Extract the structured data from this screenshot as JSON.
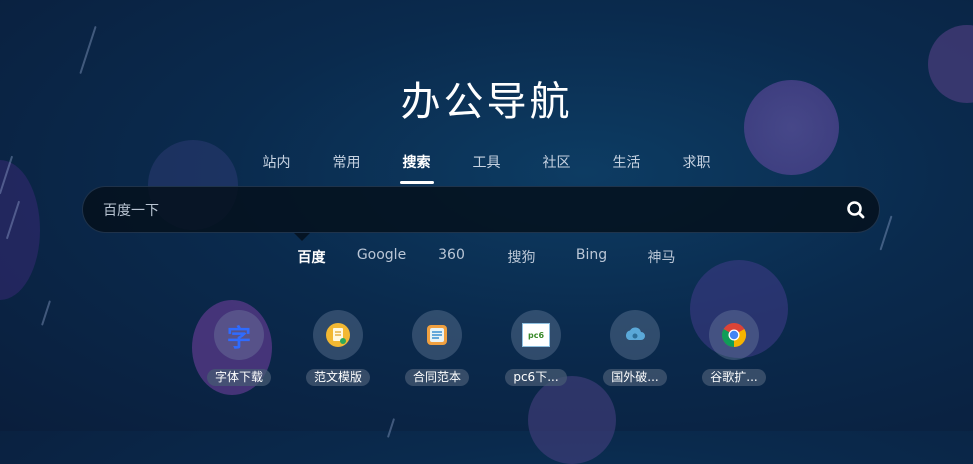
{
  "page": {
    "title": "办公导航"
  },
  "tabs": [
    {
      "label": "站内"
    },
    {
      "label": "常用"
    },
    {
      "label": "搜索",
      "active": true
    },
    {
      "label": "工具"
    },
    {
      "label": "社区"
    },
    {
      "label": "生活"
    },
    {
      "label": "求职"
    }
  ],
  "search": {
    "placeholder": "百度一下",
    "button_icon": "search-icon"
  },
  "engines": [
    {
      "label": "百度",
      "active": true
    },
    {
      "label": "Google"
    },
    {
      "label": "360"
    },
    {
      "label": "搜狗"
    },
    {
      "label": "Bing"
    },
    {
      "label": "神马"
    }
  ],
  "apps": [
    {
      "label": "字体下载",
      "icon": "font-char-icon",
      "glyph": "字"
    },
    {
      "label": "范文模版",
      "icon": "document-template-icon"
    },
    {
      "label": "合同范本",
      "icon": "contract-icon"
    },
    {
      "label": "pc6下...",
      "icon": "pc6-logo-icon",
      "glyph": "pc6"
    },
    {
      "label": "国外破...",
      "icon": "cloud-icon"
    },
    {
      "label": "谷歌扩...",
      "icon": "chrome-icon"
    }
  ],
  "colors": {
    "background": "#0a2a4d",
    "accent_text": "#ffffff",
    "font_icon_blue": "#2f6bff"
  }
}
